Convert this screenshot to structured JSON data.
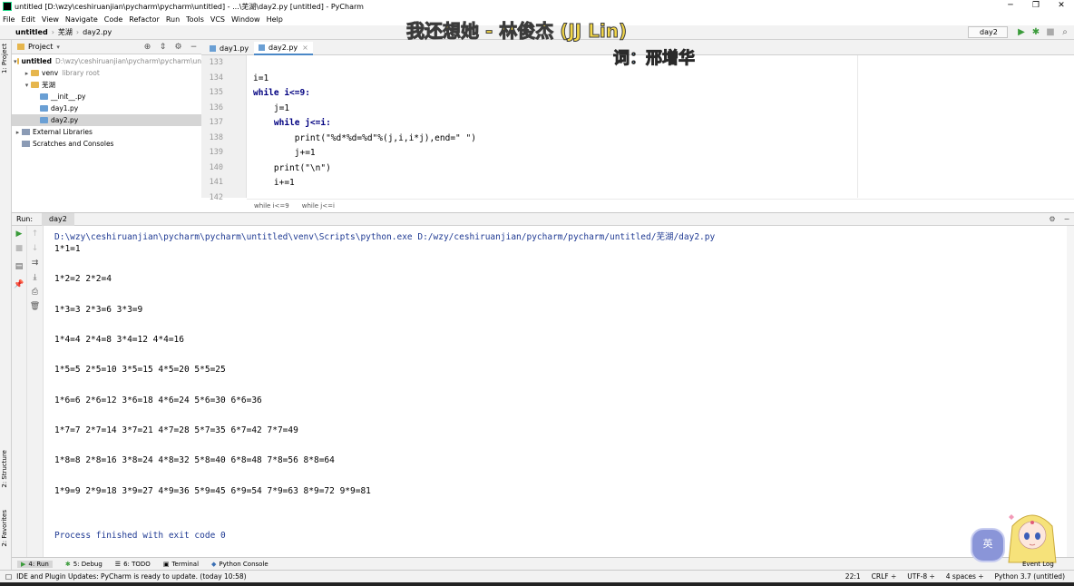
{
  "window": {
    "title": "untitled [D:\\wzy\\ceshiruanjian\\pycharm\\pycharm\\untitled] - ...\\芜湖\\day2.py [untitled] - PyCharm",
    "controls": [
      "─",
      "❐",
      "✕"
    ]
  },
  "menu": [
    "File",
    "Edit",
    "View",
    "Navigate",
    "Code",
    "Refactor",
    "Run",
    "Tools",
    "VCS",
    "Window",
    "Help"
  ],
  "nav": {
    "crumbs": [
      "untitled",
      "芜湖",
      "day2.py"
    ],
    "run_config": "day2"
  },
  "side_tools": {
    "project": "1: Project",
    "structure": "2: Structure",
    "favorites": "2: Favorites"
  },
  "project": {
    "header": "Project",
    "tree": [
      {
        "label": "untitled",
        "extra": "D:\\wzy\\ceshiruanjian\\pycharm\\pycharm\\un",
        "arrow": "▾",
        "icon": "fold",
        "bold": true
      },
      {
        "label": "venv",
        "extra": "library root",
        "arrow": "▸",
        "icon": "fold"
      },
      {
        "label": "芜湖",
        "extra": "",
        "arrow": "▾",
        "icon": "fold"
      },
      {
        "label": "__init__.py",
        "extra": "",
        "arrow": "",
        "icon": "pyf"
      },
      {
        "label": "day1.py",
        "extra": "",
        "arrow": "",
        "icon": "pyf"
      },
      {
        "label": "day2.py",
        "extra": "",
        "arrow": "",
        "icon": "pyf",
        "selected": true
      },
      {
        "label": "External Libraries",
        "extra": "",
        "arrow": "▸",
        "icon": "lib"
      },
      {
        "label": "Scratches and Consoles",
        "extra": "",
        "arrow": "",
        "icon": "lib"
      }
    ]
  },
  "editor": {
    "tabs": [
      {
        "label": "day1.py",
        "active": false
      },
      {
        "label": "day2.py",
        "active": true
      }
    ],
    "line_numbers": [
      "133",
      "134",
      "135",
      "136",
      "137",
      "138",
      "139",
      "140",
      "141",
      "142"
    ],
    "code": [
      "",
      "i=1",
      "while i<=9:",
      "    j=1",
      "    while j<=i:",
      "        print(\"%d*%d=%d\"%(j,i,i*j),end=\" \")",
      "        j+=1",
      "    print(\"\\n\")",
      "    i+=1",
      ""
    ],
    "breadcrumb": [
      "while i<=9",
      "while j<=i"
    ]
  },
  "run": {
    "label": "Run:",
    "tab": "day2",
    "command": "D:\\wzy\\ceshiruanjian\\pycharm\\pycharm\\untitled\\venv\\Scripts\\python.exe D:/wzy/ceshiruanjian/pycharm/pycharm/untitled/芜湖/day2.py",
    "output": [
      "1*1=1",
      "1*2=2 2*2=4",
      "1*3=3 2*3=6 3*3=9",
      "1*4=4 2*4=8 3*4=12 4*4=16",
      "1*5=5 2*5=10 3*5=15 4*5=20 5*5=25",
      "1*6=6 2*6=12 3*6=18 4*6=24 5*6=30 6*6=36",
      "1*7=7 2*7=14 3*7=21 4*7=28 5*7=35 6*7=42 7*7=49",
      "1*8=8 2*8=16 3*8=24 4*8=32 5*8=40 6*8=48 7*8=56 8*8=64",
      "1*9=9 2*9=18 3*9=27 4*9=36 5*9=45 6*9=54 7*9=63 8*9=72 9*9=81"
    ],
    "finished": "Process finished with exit code 0"
  },
  "bottom_tabs": [
    "4: Run",
    "5: Debug",
    "6: TODO",
    "Terminal",
    "Python Console"
  ],
  "status": {
    "message": "IDE and Plugin Updates: PyCharm is ready to update. (today 10:58)",
    "position": "22:1",
    "line_sep": "CRLF ÷",
    "encoding": "UTF-8 ÷",
    "indent": "4 spaces ÷",
    "interpreter": "Python 3.7 (untitled)",
    "event_log": "Event Log"
  },
  "overlay": {
    "lyric_line1": "我还想她 - 林俊杰 (JJ Lin)",
    "lyric_line2": "词：邢增华",
    "ime": "英"
  }
}
